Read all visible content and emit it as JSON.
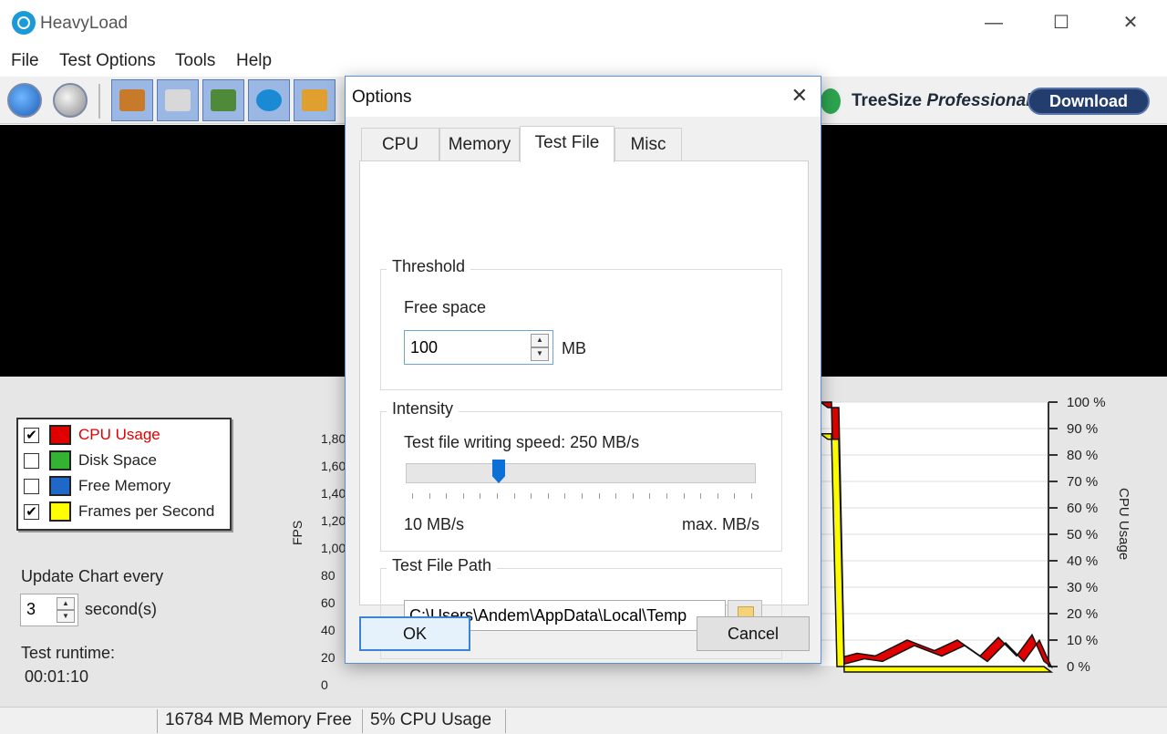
{
  "app": {
    "title": "HeavyLoad"
  },
  "menu": [
    "File",
    "Test Options",
    "Tools",
    "Help"
  ],
  "ad": {
    "brand": "TreeSize",
    "edition": "Professional",
    "button": "Download"
  },
  "legend": [
    {
      "label": "CPU Usage",
      "checked": true,
      "color": "#e00000",
      "text_color": "#e00000"
    },
    {
      "label": "Disk Space",
      "checked": false,
      "color": "#33b233",
      "text_color": "#222222"
    },
    {
      "label": "Free Memory",
      "checked": false,
      "color": "#1f68c8",
      "text_color": "#222222"
    },
    {
      "label": "Frames per Second",
      "checked": true,
      "color": "#ffff00",
      "text_color": "#222222"
    }
  ],
  "update_chart": {
    "label": "Update Chart every",
    "value": "3",
    "unit": "second(s)"
  },
  "runtime": {
    "label": "Test runtime:",
    "value": "00:01:10"
  },
  "fps_axis": {
    "label": "FPS",
    "ticks": [
      "1,80",
      "1,60",
      "1,40",
      "1,20",
      "1,00",
      "80",
      "60",
      "40",
      "20",
      "0"
    ]
  },
  "status": {
    "memory_free": "16784 MB Memory Free",
    "cpu_usage": "5% CPU Usage"
  },
  "dialog": {
    "title": "Options",
    "tabs": [
      "CPU",
      "Memory",
      "Test File",
      "Misc"
    ],
    "active_tab": 2,
    "threshold": {
      "title": "Threshold",
      "field_label": "Free space",
      "value": "100",
      "unit": "MB"
    },
    "intensity": {
      "title": "Intensity",
      "speed_label": "Test file writing speed: 250 MB/s",
      "min_label": "10 MB/s",
      "max_label": "max. MB/s",
      "slider_fraction": 0.25
    },
    "path": {
      "title": "Test File Path",
      "value": "C:\\Users\\Andem\\AppData\\Local\\Temp"
    },
    "ok": "OK",
    "cancel": "Cancel"
  },
  "chart_data": {
    "type": "line",
    "y2label": "CPU Usage",
    "y2ticks": [
      "100 %",
      "90 %",
      "80 %",
      "70 %",
      "60 %",
      "50 %",
      "40 %",
      "30 %",
      "20 %",
      "10 %",
      "0 %"
    ],
    "ylim": [
      0,
      100
    ],
    "series": [
      {
        "name": "CPU Usage",
        "color": "#e00000",
        "values": [
          100,
          100,
          3,
          5,
          4,
          10,
          6,
          10,
          4,
          11,
          4,
          12,
          2
        ]
      },
      {
        "name": "Frames per Second",
        "color": "#ffff00",
        "values": [
          88,
          88,
          0,
          0,
          0,
          0,
          0,
          0,
          0,
          0,
          0,
          0,
          0
        ]
      }
    ]
  }
}
